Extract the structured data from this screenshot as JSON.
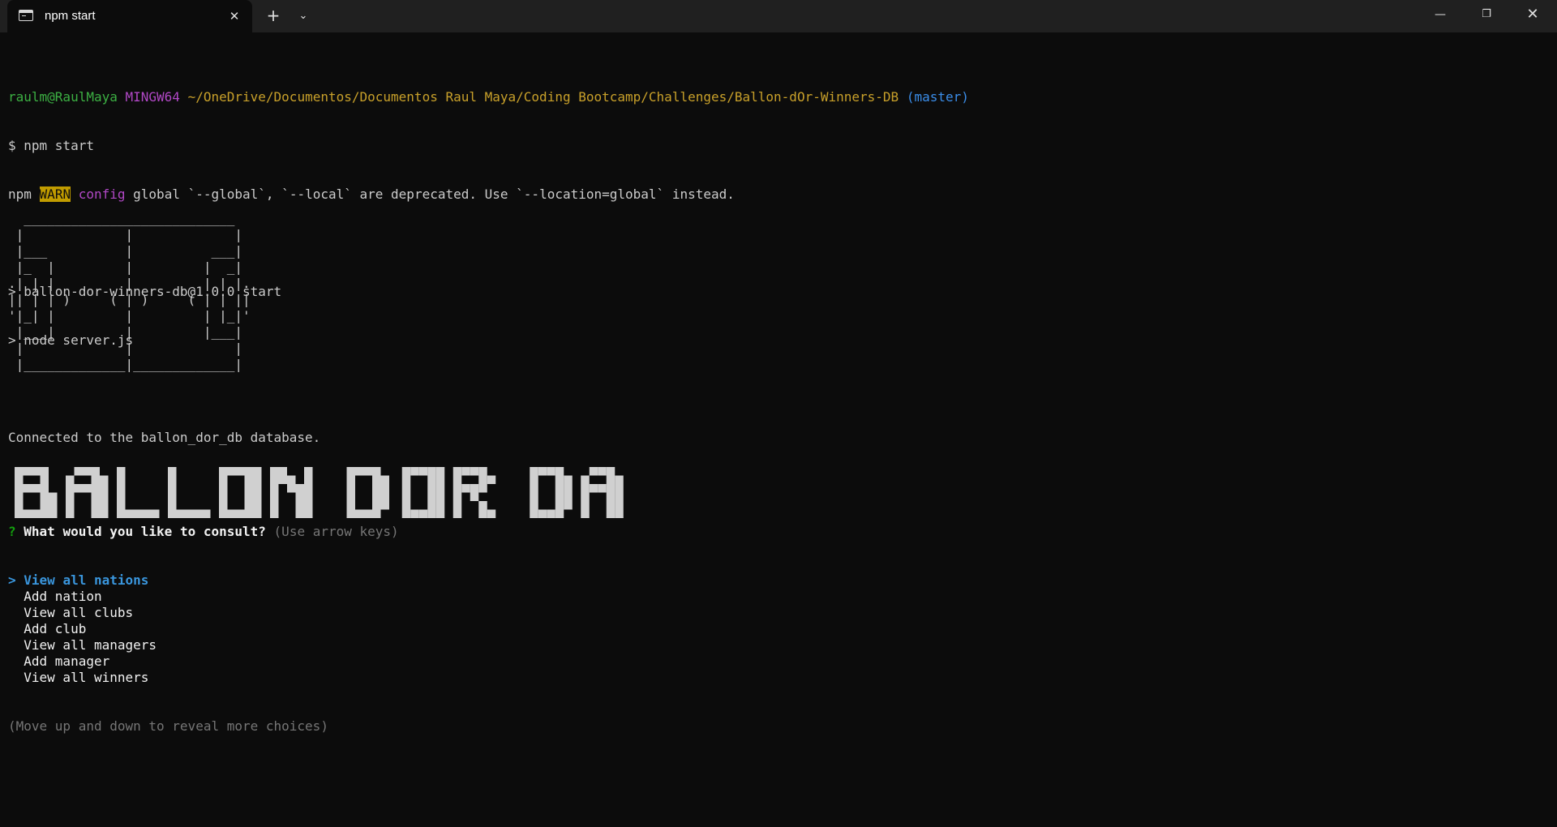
{
  "window": {
    "tab_title": "npm start",
    "tab_close": "✕",
    "new_tab": "+",
    "dropdown": "⌄",
    "minimize": "—",
    "restore": "❐",
    "close": "✕"
  },
  "terminal": {
    "prompt_user": "raulm@RaulMaya",
    "prompt_env": "MINGW64",
    "prompt_path": "~/OneDrive/Documentos/Documentos Raul Maya/Coding Bootcamp/Challenges/Ballon-dOr-Winners-DB",
    "prompt_branch": "(master)",
    "command": "$ npm start",
    "warn_prefix": "npm",
    "warn_badge": "WARN",
    "warn_kind": "config",
    "warn_text": "global `--global`, `--local` are deprecated. Use `--location=global` instead.",
    "script_line1": "> ballon-dor-winners-db@1.0.0 start",
    "script_line2": "> node server.js",
    "connected": "Connected to the ballon_dor_db database.",
    "ascii_art": [
      "  ___________________________",
      " |             |             |",
      " |___          |          ___|",
      " |_  |         |         |  _|",
      ".| | |         |         | | |.",
      "|| | | )     ( | )     ( | | ||",
      "'|_| |         |         | |_|'",
      " |___|         |         |___|",
      " |             |             |",
      " |_____________|_____________|"
    ],
    "banner_text": "BALLON D'OR DATABASE",
    "question_mark": "?",
    "question": "What would you like to consult?",
    "question_hint": "(Use arrow keys)",
    "selected_pointer": ">",
    "choices": [
      "View all nations",
      "Add nation",
      "View all clubs",
      "Add club",
      "View all managers",
      "Add manager",
      "View all winners"
    ],
    "more_hint": "(Move up and down to reveal more choices)"
  },
  "colors": {
    "background": "#0c0c0c",
    "titlebar": "#202020",
    "banner": "#d0d0d0"
  }
}
